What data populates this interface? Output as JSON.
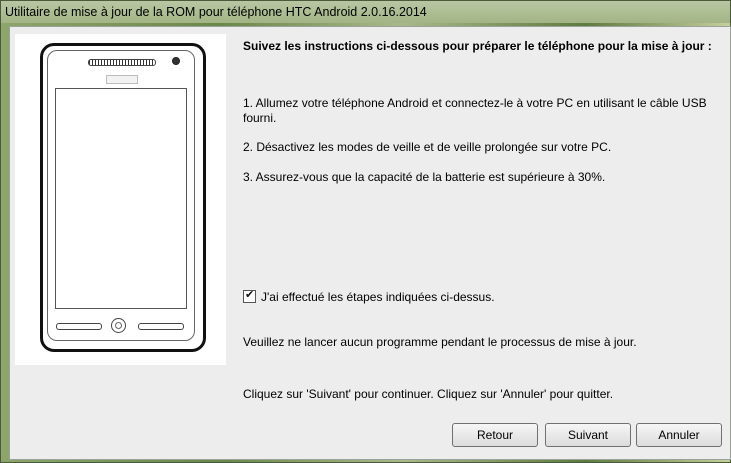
{
  "window": {
    "title": "Utilitaire de mise à jour de la ROM pour téléphone HTC Android 2.0.16.2014"
  },
  "instructions": {
    "heading": "Suivez les instructions ci-dessous pour préparer le téléphone pour la mise à jour :",
    "steps": [
      "1. Allumez votre téléphone Android et connectez-le à votre PC en utilisant le câble USB fourni.",
      "2. Désactivez les modes de veille et de veille prolongée sur votre PC.",
      "3. Assurez-vous que la capacité de la batterie est supérieure à 30%."
    ]
  },
  "confirmation": {
    "checkbox_label": "J'ai effectué les étapes indiquées ci-dessus.",
    "checked": true
  },
  "notes": {
    "warning": "Veuillez ne lancer aucun programme pendant le processus de mise à jour.",
    "navigation_hint": "Cliquez sur 'Suivant' pour continuer. Cliquez sur 'Annuler' pour quitter."
  },
  "buttons": {
    "back": "Retour",
    "next": "Suivant",
    "cancel": "Annuler"
  },
  "icons": {
    "checkbox": "checkmark-icon",
    "illustration": "phone-illustration"
  }
}
